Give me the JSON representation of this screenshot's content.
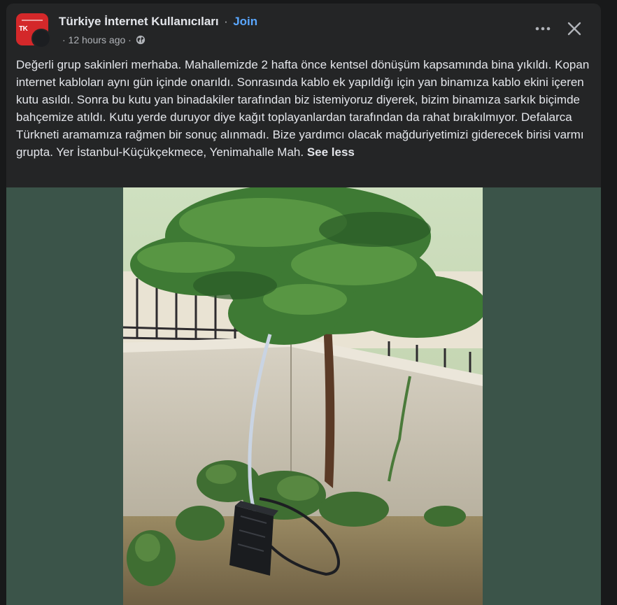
{
  "post": {
    "group_name": "Türkiye İnternet Kullanıcıları",
    "separator": "·",
    "join_label": "Join",
    "timestamp": "· 12 hours ago ·",
    "privacy_icon": "globe-icon",
    "avatar_mark": "TK",
    "text": "Değerli grup sakinleri merhaba. Mahallemizde 2 hafta önce kentsel dönüşüm kapsamında bina yıkıldı. Kopan internet kabloları aynı gün içinde onarıldı. Sonrasında kablo ek yapıldığı için yan binamıza kablo ekini içeren kutu asıldı. Sonra bu kutu yan binadakiler tarafından biz istemiyoruz diyerek, bizim binamıza sarkık biçimde bahçemize atıldı. Kutu yerde duruyor diye kağıt toplayanlardan tarafından da rahat bırakılmıyor. Defalarca Türkneti aramamıza rağmen bir sonuç alınmadı. Bize yardımcı olacak mağduriyetimizi giderecek birisi varmı grupta. Yer İstanbul-Küçükçekmece, Yenimahalle Mah.",
    "see_less_label": "See less"
  },
  "icons": {
    "more": "more-options-icon",
    "close": "close-icon"
  },
  "colors": {
    "background": "#18191a",
    "card": "#242526",
    "text_primary": "#e4e6eb",
    "text_secondary": "#b0b3b8",
    "join_link": "#5aa7ff",
    "media_backdrop": "#3b5449",
    "avatar_brand": "#d4282a"
  }
}
